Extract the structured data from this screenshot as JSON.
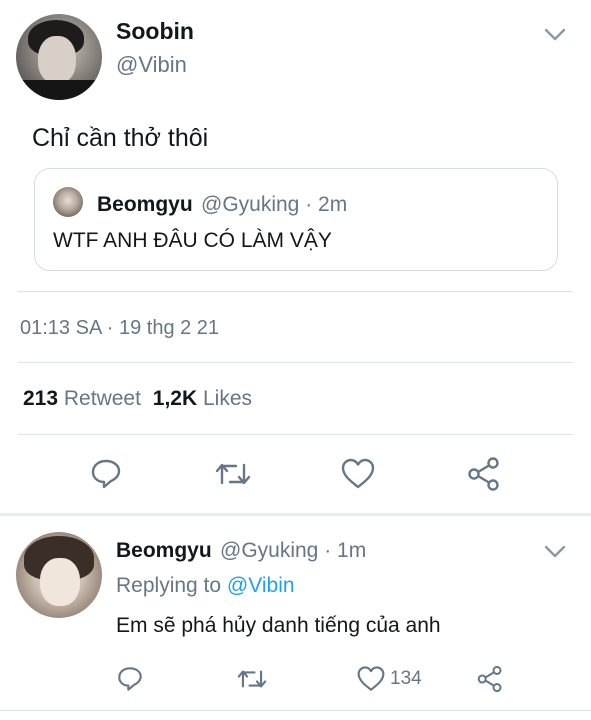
{
  "tweet": {
    "author_name": "Soobin",
    "author_handle": "@Vibin",
    "text": "Chỉ cần thở thôi",
    "quote": {
      "author_name": "Beomgyu",
      "meta": "@Gyuking · 2m",
      "text": "WTF ANH ĐÂU CÓ LÀM VẬY"
    },
    "timestamp": "01:13 SA · 19 thg 2 21",
    "stats": {
      "retweet_count": "213",
      "retweet_label": "Retweet",
      "likes_count": "1,2K",
      "likes_label": "Likes"
    }
  },
  "reply": {
    "author_name": "Beomgyu",
    "meta": "@Gyuking · 1m",
    "replying_prefix": "Replying to",
    "replying_mention": "@Vibin",
    "text": "Em sẽ phá hủy danh tiếng của anh",
    "like_count": "134"
  },
  "icons": {
    "reply": "reply-icon",
    "retweet": "retweet-icon",
    "like": "heart-icon",
    "share": "share-icon",
    "menu": "chevron-down-icon"
  },
  "colors": {
    "text": "#14171a",
    "secondary": "#657786",
    "accent": "#1da1f2",
    "border": "#dce2e6"
  }
}
